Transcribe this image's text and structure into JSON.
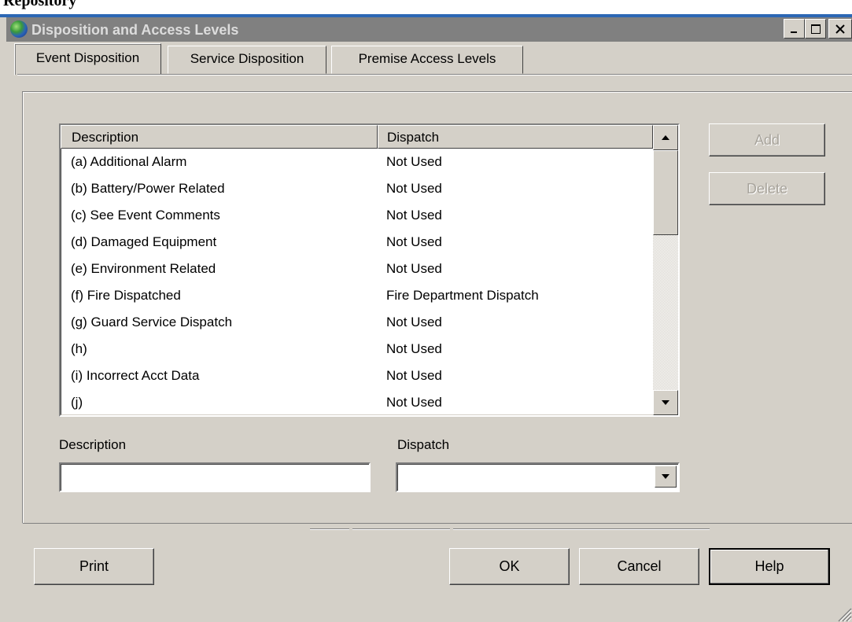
{
  "colors": {
    "window_bg": "#d4d0c8",
    "titlebar_bg": "#808080",
    "titlebar_text": "#dcdcdc",
    "disabled_text": "#a8a49c",
    "strip_accent": "#2c67b4"
  },
  "top_strip": {
    "text": "Repository"
  },
  "window": {
    "title": "Disposition and Access Levels",
    "icon": "globe-icon",
    "controls": {
      "minimize": "minimize-icon",
      "maximize": "maximize-icon",
      "close": "close-icon"
    }
  },
  "tabs": [
    {
      "label": "Event Disposition",
      "active": true
    },
    {
      "label": "Service Disposition",
      "active": false
    },
    {
      "label": "Premise Access Levels",
      "active": false
    }
  ],
  "list": {
    "columns": [
      "Description",
      "Dispatch"
    ],
    "rows": [
      {
        "description": "(a) Additional Alarm",
        "dispatch": "Not Used"
      },
      {
        "description": "(b) Battery/Power Related",
        "dispatch": "Not Used"
      },
      {
        "description": "(c) See Event Comments",
        "dispatch": "Not Used"
      },
      {
        "description": "(d) Damaged Equipment",
        "dispatch": "Not Used"
      },
      {
        "description": "(e) Environment Related",
        "dispatch": "Not Used"
      },
      {
        "description": "(f) Fire Dispatched",
        "dispatch": "Fire Department Dispatch"
      },
      {
        "description": "(g) Guard Service Dispatch",
        "dispatch": "Not Used"
      },
      {
        "description": "(h)",
        "dispatch": "Not Used"
      },
      {
        "description": "(i) Incorrect Acct Data",
        "dispatch": "Not Used"
      },
      {
        "description": "(j)",
        "dispatch": "Not Used"
      }
    ]
  },
  "side_buttons": {
    "add": "Add",
    "delete": "Delete"
  },
  "form": {
    "description_label": "Description",
    "description_value": "",
    "dispatch_label": "Dispatch",
    "dispatch_value": ""
  },
  "footer": {
    "print": "Print",
    "ok": "OK",
    "cancel": "Cancel",
    "help": "Help"
  }
}
